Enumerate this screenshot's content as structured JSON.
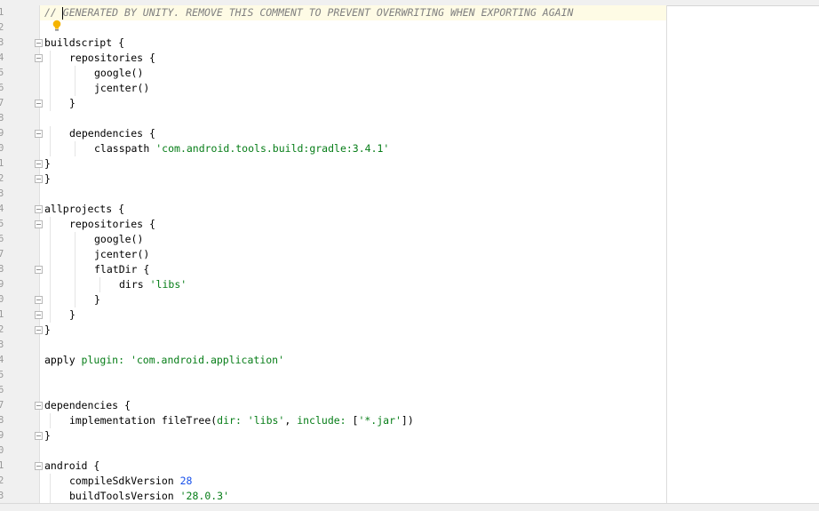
{
  "editor": {
    "lines": [
      {
        "num": "1",
        "fold": false,
        "current": true,
        "indent": 0,
        "segments": [
          {
            "t": "// GENERATED BY UNITY. REMOVE THIS COMMENT TO PREVENT OVERWRITING WHEN EXPORTING AGAIN",
            "c": "comment"
          }
        ]
      },
      {
        "num": "2",
        "fold": false,
        "indent": 0,
        "segments": []
      },
      {
        "num": "3",
        "fold": true,
        "indent": 0,
        "segments": [
          {
            "t": "buildscript {",
            "c": "plain"
          }
        ]
      },
      {
        "num": "4",
        "fold": true,
        "indent": 1,
        "segments": [
          {
            "t": "repositories {",
            "c": "plain"
          }
        ]
      },
      {
        "num": "5",
        "fold": false,
        "indent": 2,
        "segments": [
          {
            "t": "google()",
            "c": "plain"
          }
        ]
      },
      {
        "num": "6",
        "fold": false,
        "indent": 2,
        "segments": [
          {
            "t": "jcenter()",
            "c": "plain"
          }
        ]
      },
      {
        "num": "7",
        "fold": true,
        "indent": 1,
        "segments": [
          {
            "t": "}",
            "c": "plain"
          }
        ]
      },
      {
        "num": "8",
        "fold": false,
        "indent": 0,
        "segments": []
      },
      {
        "num": "9",
        "fold": true,
        "indent": 1,
        "segments": [
          {
            "t": "dependencies {",
            "c": "plain"
          }
        ]
      },
      {
        "num": "0",
        "fold": false,
        "indent": 2,
        "segments": [
          {
            "t": "classpath ",
            "c": "plain"
          },
          {
            "t": "'com.android.tools.build:gradle:3.4.1'",
            "c": "string"
          }
        ]
      },
      {
        "num": "1",
        "fold": true,
        "indent": 0,
        "segments": [
          {
            "t": "}",
            "c": "plain"
          }
        ]
      },
      {
        "num": "2",
        "fold": true,
        "indent": 0,
        "segments": [
          {
            "t": "}",
            "c": "plain"
          }
        ]
      },
      {
        "num": "3",
        "fold": false,
        "indent": 0,
        "segments": []
      },
      {
        "num": "4",
        "fold": true,
        "indent": 0,
        "segments": [
          {
            "t": "allprojects {",
            "c": "plain"
          }
        ]
      },
      {
        "num": "5",
        "fold": true,
        "indent": 1,
        "segments": [
          {
            "t": "repositories {",
            "c": "plain"
          }
        ]
      },
      {
        "num": "6",
        "fold": false,
        "indent": 2,
        "segments": [
          {
            "t": "google()",
            "c": "plain"
          }
        ]
      },
      {
        "num": "7",
        "fold": false,
        "indent": 2,
        "segments": [
          {
            "t": "jcenter()",
            "c": "plain"
          }
        ]
      },
      {
        "num": "8",
        "fold": true,
        "indent": 2,
        "segments": [
          {
            "t": "flatDir {",
            "c": "plain"
          }
        ]
      },
      {
        "num": "9",
        "fold": false,
        "indent": 3,
        "segments": [
          {
            "t": "dirs ",
            "c": "plain"
          },
          {
            "t": "'libs'",
            "c": "string"
          }
        ]
      },
      {
        "num": "0",
        "fold": true,
        "indent": 2,
        "segments": [
          {
            "t": "}",
            "c": "plain"
          }
        ]
      },
      {
        "num": "1",
        "fold": true,
        "indent": 1,
        "segments": [
          {
            "t": "}",
            "c": "plain"
          }
        ]
      },
      {
        "num": "2",
        "fold": true,
        "indent": 0,
        "segments": [
          {
            "t": "}",
            "c": "plain"
          }
        ]
      },
      {
        "num": "3",
        "fold": false,
        "indent": 0,
        "segments": []
      },
      {
        "num": "4",
        "fold": false,
        "indent": 0,
        "segments": [
          {
            "t": "apply ",
            "c": "plain"
          },
          {
            "t": "plugin: ",
            "c": "param"
          },
          {
            "t": "'com.android.application'",
            "c": "string"
          }
        ]
      },
      {
        "num": "5",
        "fold": false,
        "indent": 0,
        "segments": []
      },
      {
        "num": "6",
        "fold": false,
        "indent": 0,
        "segments": []
      },
      {
        "num": "7",
        "fold": true,
        "indent": 0,
        "segments": [
          {
            "t": "dependencies {",
            "c": "plain"
          }
        ]
      },
      {
        "num": "8",
        "fold": false,
        "indent": 1,
        "segments": [
          {
            "t": "implementation fileTree(",
            "c": "plain"
          },
          {
            "t": "dir: ",
            "c": "param"
          },
          {
            "t": "'libs'",
            "c": "string"
          },
          {
            "t": ", ",
            "c": "plain"
          },
          {
            "t": "include: ",
            "c": "param"
          },
          {
            "t": "[",
            "c": "plain"
          },
          {
            "t": "'*.jar'",
            "c": "string"
          },
          {
            "t": "])",
            "c": "plain"
          }
        ]
      },
      {
        "num": "9",
        "fold": true,
        "indent": 0,
        "segments": [
          {
            "t": "}",
            "c": "plain"
          }
        ]
      },
      {
        "num": "0",
        "fold": false,
        "indent": 0,
        "segments": []
      },
      {
        "num": "1",
        "fold": true,
        "indent": 0,
        "segments": [
          {
            "t": "android {",
            "c": "plain"
          }
        ]
      },
      {
        "num": "2",
        "fold": false,
        "indent": 1,
        "segments": [
          {
            "t": "compileSdkVersion ",
            "c": "plain"
          },
          {
            "t": "28",
            "c": "number"
          }
        ]
      },
      {
        "num": "3",
        "fold": false,
        "indent": 1,
        "segments": [
          {
            "t": "buildToolsVersion ",
            "c": "plain"
          },
          {
            "t": "'28.0.3'",
            "c": "string"
          }
        ]
      }
    ],
    "icons": {
      "intention": "lightbulb-icon"
    },
    "colors": {
      "comment": "#808080",
      "string": "#067d17",
      "number": "#1750eb",
      "current_line": "#fefbe5",
      "gutter": "#f0f0f0"
    }
  }
}
